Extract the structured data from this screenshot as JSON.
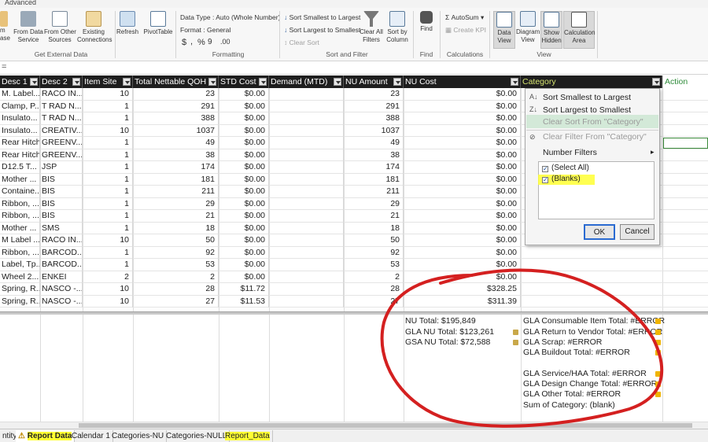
{
  "ribbon": {
    "tab_label": "Advanced",
    "buttons": {
      "paste_tail": "m\nase",
      "from_data_service": "From Data\nService",
      "from_other_sources": "From Other\nSources",
      "existing_connections": "Existing\nConnections",
      "refresh": "Refresh",
      "pivottable": "PivotTable",
      "find": "Find",
      "data_view": "Data\nView",
      "diagram_view": "Diagram\nView",
      "show_hidden": "Show\nHidden",
      "calculation_area": "Calculation\nArea",
      "clear_all_filters": "Clear All\nFilters",
      "sort_by_column": "Sort by\nColumn"
    },
    "formatting": {
      "data_type": "Data Type : Auto (Whole Number)",
      "format": "Format : General",
      "currency": "$",
      "comma": ",",
      "percent": "%",
      "symbols": "9",
      "decimals": ".00"
    },
    "sort": {
      "asc": "Sort Smallest to Largest",
      "desc": "Sort Largest to Smallest",
      "clear": "Clear Sort"
    },
    "calc": {
      "autosum": "AutoSum",
      "create_kpi": "Create KPI"
    },
    "groups": {
      "get_external_data": "Get External Data",
      "formatting": "Formatting",
      "sort_and_filter": "Sort and Filter",
      "find": "Find",
      "calculations": "Calculations",
      "view": "View"
    }
  },
  "formula_bar": {
    "text": "="
  },
  "table": {
    "columns": [
      "Desc 1",
      "Desc 2",
      "Item Site",
      "Total Nettable QOH",
      "STD Cost",
      "Demand (MTD)",
      "NU Amount",
      "NU Cost",
      "Category",
      "Action"
    ],
    "rows": [
      [
        "M. Label...",
        "RACO IN...",
        "10",
        "23",
        "$0.00",
        "",
        "23",
        "$0.00"
      ],
      [
        "Clamp, P...",
        "T RAD N...",
        "1",
        "291",
        "$0.00",
        "",
        "291",
        "$0.00"
      ],
      [
        "Insulato...",
        "T RAD N...",
        "1",
        "388",
        "$0.00",
        "",
        "388",
        "$0.00"
      ],
      [
        "Insulato...",
        "CREATIV...",
        "10",
        "1037",
        "$0.00",
        "",
        "1037",
        "$0.00"
      ],
      [
        "Rear Hitch",
        "GREENV...",
        "1",
        "49",
        "$0.00",
        "",
        "49",
        "$0.00"
      ],
      [
        "Rear Hitch",
        "GREENV...",
        "1",
        "38",
        "$0.00",
        "",
        "38",
        "$0.00"
      ],
      [
        "D12.5 T...",
        "JSP",
        "1",
        "174",
        "$0.00",
        "",
        "174",
        "$0.00"
      ],
      [
        "Mother ...",
        "BIS",
        "1",
        "181",
        "$0.00",
        "",
        "181",
        "$0.00"
      ],
      [
        "Containe...",
        "BIS",
        "1",
        "211",
        "$0.00",
        "",
        "211",
        "$0.00"
      ],
      [
        "Ribbon, ...",
        "BIS",
        "1",
        "29",
        "$0.00",
        "",
        "29",
        "$0.00"
      ],
      [
        "Ribbon, ...",
        "BIS",
        "1",
        "21",
        "$0.00",
        "",
        "21",
        "$0.00"
      ],
      [
        "Mother ...",
        "SMS",
        "1",
        "18",
        "$0.00",
        "",
        "18",
        "$0.00"
      ],
      [
        "M Label ...",
        "RACO IN...",
        "10",
        "50",
        "$0.00",
        "",
        "50",
        "$0.00"
      ],
      [
        "Ribbon, ...",
        "BARCOD...",
        "1",
        "92",
        "$0.00",
        "",
        "92",
        "$0.00"
      ],
      [
        "Label, Tp...",
        "BARCOD...",
        "1",
        "53",
        "$0.00",
        "",
        "53",
        "$0.00"
      ],
      [
        "Wheel 2...",
        "ENKEI",
        "2",
        "2",
        "$0.00",
        "",
        "2",
        "$0.00"
      ],
      [
        "Spring, R...",
        "NASCO -...",
        "10",
        "28",
        "$11.72",
        "",
        "28",
        "$328.25"
      ],
      [
        "Spring, R...",
        "NASCO -...",
        "10",
        "27",
        "$11.53",
        "",
        "27",
        "$311.39"
      ]
    ]
  },
  "measures": {
    "nu_total": "NU Total: $195,849",
    "gla_nu_total": "GLA NU Total: $123,261",
    "gsa_nu_total": "GSA NU Total: $72,588",
    "category": [
      "GLA Consumable Item Total: #ERROR",
      "GLA Return to Vendor Total: #ERROR",
      "GLA Scrap: #ERROR",
      "GLA Buildout Total: #ERROR",
      "GLA Service/HAA Total: #ERROR",
      "GLA Design Change Total: #ERROR",
      "GLA Other Total: #ERROR",
      "Sum of Category: (blank)"
    ]
  },
  "filter_menu": {
    "sort_asc": "Sort Smallest to Largest",
    "sort_desc": "Sort Largest to Smallest",
    "clear_sort": "Clear Sort From \"Category\"",
    "clear_filter": "Clear Filter From \"Category\"",
    "number_filters": "Number Filters",
    "options": [
      "(Select All)",
      "(Blanks)"
    ],
    "ok": "OK",
    "cancel": "Cancel"
  },
  "sheet_tabs": [
    "ntity",
    "Report Data",
    "Calendar 1",
    "Categories-NU",
    "Categories-NULL",
    "Report_Data"
  ],
  "colors": {
    "header_bg": "#1e1e1e",
    "category_header": "#d4e26f",
    "action_header": "#2e8b3a",
    "highlight": "#ffff33",
    "ink": "#d42020"
  }
}
